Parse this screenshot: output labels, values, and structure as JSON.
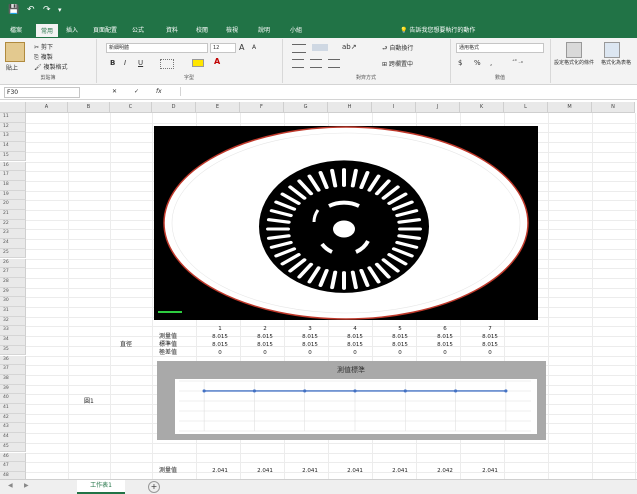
{
  "quick_access": {
    "save": "💾",
    "undo": "↶",
    "redo": "↷",
    "more": "▾"
  },
  "tabs": [
    "檔案",
    "常用",
    "插入",
    "頁面配置",
    "公式",
    "資料",
    "校閱",
    "檢視",
    "說明",
    "小組"
  ],
  "active_tab": "常用",
  "tell_me": "告訴我您想要執行的動作",
  "ribbon": {
    "clipboard": {
      "paste": "貼上",
      "cut": "剪下",
      "copy": "複製",
      "format_painter": "複製格式",
      "label": "剪貼簿"
    },
    "font": {
      "name": "新細明體",
      "size": "12",
      "grow": "A",
      "shrink": "A",
      "bold": "B",
      "italic": "I",
      "underline": "U",
      "label": "字型"
    },
    "alignment": {
      "wrap": "自動換行",
      "merge": "跨欄置中",
      "label": "對齊方式"
    },
    "number": {
      "format": "通用格式",
      "currency": "$",
      "percent": "%",
      "comma": ",",
      "label": "數值"
    },
    "styles": {
      "conditional": "設定格式化的條件",
      "as_table": "格式化為表格"
    }
  },
  "formula_bar": {
    "name_box": "F30",
    "cancel": "✕",
    "enter": "✓",
    "fx": "fx",
    "value": ""
  },
  "columns": [
    "A",
    "B",
    "C",
    "D",
    "E",
    "F",
    "G",
    "H",
    "I",
    "J",
    "K",
    "L",
    "M",
    "N"
  ],
  "rows": [
    "11",
    "12",
    "13",
    "14",
    "15",
    "16",
    "17",
    "18",
    "19",
    "20",
    "21",
    "22",
    "23",
    "24",
    "25",
    "26",
    "27",
    "28",
    "29",
    "30",
    "31",
    "32",
    "33",
    "34",
    "35",
    "36",
    "37",
    "38",
    "39",
    "40",
    "41",
    "42",
    "43",
    "44",
    "45",
    "46",
    "47",
    "48"
  ],
  "sheet": {
    "diameter_label": "直徑",
    "group_label": "圓1",
    "row_labels": [
      "測量值",
      "標準值",
      "極差值"
    ],
    "bottom_label": "測量值",
    "indices": [
      "1",
      "2",
      "3",
      "4",
      "5",
      "6",
      "7"
    ],
    "measured": [
      "8.015",
      "8.015",
      "8.015",
      "8.015",
      "8.015",
      "8.015",
      "8.015"
    ],
    "standard": [
      "8.015",
      "8.015",
      "8.015",
      "8.015",
      "8.015",
      "8.015",
      "8.015"
    ],
    "range": [
      "0",
      "0",
      "0",
      "0",
      "0",
      "0",
      "0"
    ],
    "bottom_values": [
      "2.041",
      "2.041",
      "2.041",
      "2.041",
      "2.041",
      "2.042",
      "2.041"
    ]
  },
  "chart_data": {
    "type": "line",
    "title": "測值標準",
    "x": [
      1,
      2,
      3,
      4,
      5,
      6,
      7
    ],
    "series": [
      {
        "values": [
          8.015,
          8.015,
          8.015,
          8.015,
          8.015,
          8.015,
          8.015
        ],
        "color": "#4472c4"
      }
    ],
    "grid": true
  },
  "sheet_tab": "工作表1",
  "add_sheet": "+",
  "colors": {
    "excel_green": "#217346",
    "series_blue": "#4472c4",
    "rim_red": "#c0392b"
  }
}
